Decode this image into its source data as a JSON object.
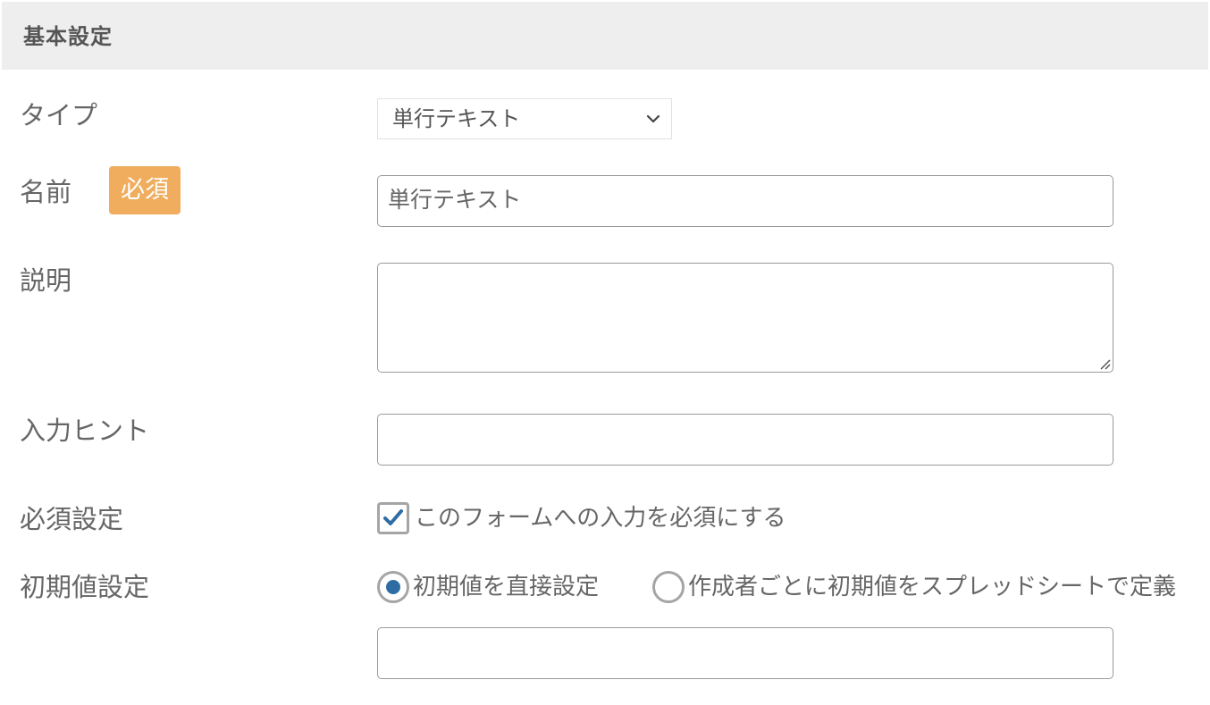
{
  "section": {
    "title": "基本設定"
  },
  "fields": {
    "type": {
      "label": "タイプ",
      "selected": "単行テキスト"
    },
    "name": {
      "label": "名前",
      "required_badge": "必須",
      "value": "単行テキスト"
    },
    "description": {
      "label": "説明",
      "value": ""
    },
    "hint": {
      "label": "入力ヒント",
      "value": ""
    },
    "required_setting": {
      "label": "必須設定",
      "checkbox_label": "このフォームへの入力を必須にする",
      "checked": true
    },
    "default_value": {
      "label": "初期値設定",
      "options": [
        {
          "label": "初期値を直接設定",
          "selected": true
        },
        {
          "label": "作成者ごとに初期値をスプレッドシートで定義",
          "selected": false
        }
      ],
      "value": ""
    }
  },
  "colors": {
    "header_bg": "#eeeeee",
    "badge_bg": "#f0ad5e",
    "accent": "#2e6da4"
  },
  "icons": {
    "select_arrow": "chevron-down-icon",
    "checkbox_mark": "checkmark-icon",
    "textarea_resize": "resize-handle-icon"
  }
}
